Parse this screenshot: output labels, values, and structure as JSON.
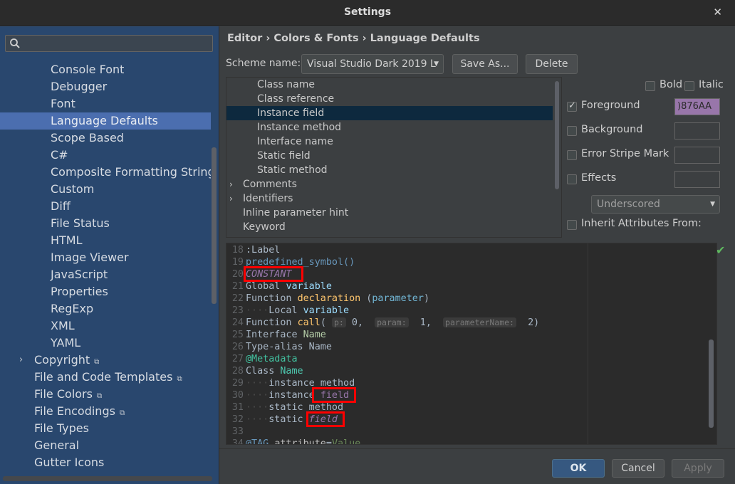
{
  "window": {
    "title": "Settings"
  },
  "sidebar": {
    "search_placeholder": "",
    "items": [
      {
        "label": "Console Font",
        "indent": 2
      },
      {
        "label": "Debugger",
        "indent": 2
      },
      {
        "label": "Font",
        "indent": 2
      },
      {
        "label": "Language Defaults",
        "indent": 2,
        "selected": true
      },
      {
        "label": "Scope Based",
        "indent": 2
      },
      {
        "label": "C#",
        "indent": 2
      },
      {
        "label": "Composite Formatting String",
        "indent": 2
      },
      {
        "label": "Custom",
        "indent": 2
      },
      {
        "label": "Diff",
        "indent": 2
      },
      {
        "label": "File Status",
        "indent": 2
      },
      {
        "label": "HTML",
        "indent": 2
      },
      {
        "label": "Image Viewer",
        "indent": 2
      },
      {
        "label": "JavaScript",
        "indent": 2
      },
      {
        "label": "Properties",
        "indent": 2
      },
      {
        "label": "RegExp",
        "indent": 2
      },
      {
        "label": "XML",
        "indent": 2
      },
      {
        "label": "YAML",
        "indent": 2
      },
      {
        "label": "Copyright",
        "indent": 1,
        "expandable": true,
        "copy_icon": true
      },
      {
        "label": "File and Code Templates",
        "indent": 1,
        "copy_icon": true
      },
      {
        "label": "File Colors",
        "indent": 1,
        "copy_icon": true
      },
      {
        "label": "File Encodings",
        "indent": 1,
        "copy_icon": true
      },
      {
        "label": "File Types",
        "indent": 1
      },
      {
        "label": "General",
        "indent": 1
      },
      {
        "label": "Gutter Icons",
        "indent": 1
      }
    ]
  },
  "breadcrumb": "Editor › Colors & Fonts › Language Defaults",
  "scheme": {
    "label": "Scheme name:",
    "value": "Visual Studio Dark 2019 L",
    "save_as": "Save As...",
    "delete": "Delete"
  },
  "attributes": {
    "items": [
      {
        "label": "Class name",
        "level": 1
      },
      {
        "label": "Class reference",
        "level": 1
      },
      {
        "label": "Instance field",
        "level": 1,
        "selected": true
      },
      {
        "label": "Instance method",
        "level": 1
      },
      {
        "label": "Interface name",
        "level": 1
      },
      {
        "label": "Static field",
        "level": 1
      },
      {
        "label": "Static method",
        "level": 1
      },
      {
        "label": "Comments",
        "level": 0,
        "expandable": true
      },
      {
        "label": "Identifiers",
        "level": 0,
        "expandable": true
      },
      {
        "label": "Inline parameter hint",
        "level": 0
      },
      {
        "label": "Keyword",
        "level": 0
      }
    ]
  },
  "options": {
    "bold": "Bold",
    "italic": "Italic",
    "foreground": "Foreground",
    "foreground_value": ")876AA",
    "foreground_color": "#9876aa",
    "background": "Background",
    "error_stripe": "Error Stripe Mark",
    "effects": "Effects",
    "effects_type": "Underscored",
    "inherit": "Inherit Attributes From:"
  },
  "preview": {
    "lines": [
      {
        "n": "18",
        "parts": [
          [
            "k-label",
            ":Label"
          ]
        ]
      },
      {
        "n": "19",
        "parts": [
          [
            "k-predef",
            "predefined_symbol()"
          ]
        ]
      },
      {
        "n": "20",
        "parts": [
          [
            "k-const",
            "CONSTANT"
          ]
        ]
      },
      {
        "n": "21",
        "parts": [
          [
            "",
            "Global "
          ],
          [
            "k-var",
            "variable"
          ]
        ]
      },
      {
        "n": "22",
        "parts": [
          [
            "",
            "Function "
          ],
          [
            "k-func",
            "declaration"
          ],
          [
            "",
            " ("
          ],
          [
            "k-param",
            "parameter"
          ],
          [
            "",
            ")"
          ]
        ]
      },
      {
        "n": "23",
        "parts": [
          [
            "indent",
            "····"
          ],
          [
            "",
            "Local "
          ],
          [
            "k-var",
            "variable"
          ]
        ]
      },
      {
        "n": "24",
        "parts": [
          [
            "",
            "Function "
          ],
          [
            "k-func",
            "call"
          ],
          [
            "",
            "( "
          ],
          [
            "hint",
            "p:"
          ],
          [
            "",
            " 0,  "
          ],
          [
            "hint",
            "param:"
          ],
          [
            "",
            "  1,  "
          ],
          [
            "hint",
            "parameterName:"
          ],
          [
            "",
            "  2)"
          ]
        ]
      },
      {
        "n": "25",
        "parts": [
          [
            "",
            "Interface "
          ],
          [
            "k-iface",
            "Name"
          ]
        ]
      },
      {
        "n": "26",
        "parts": [
          [
            "",
            "Type-alias Name"
          ]
        ]
      },
      {
        "n": "27",
        "parts": [
          [
            "k-meta",
            "@Metadata"
          ]
        ]
      },
      {
        "n": "28",
        "parts": [
          [
            "",
            "Class "
          ],
          [
            "k-cls",
            "Name"
          ]
        ]
      },
      {
        "n": "29",
        "parts": [
          [
            "indent",
            "····"
          ],
          [
            "",
            "instance "
          ],
          [
            "",
            "method"
          ]
        ]
      },
      {
        "n": "30",
        "parts": [
          [
            "indent",
            "····"
          ],
          [
            "",
            "instance "
          ],
          [
            "k-field",
            "field"
          ]
        ]
      },
      {
        "n": "31",
        "parts": [
          [
            "indent",
            "····"
          ],
          [
            "",
            "static method"
          ]
        ]
      },
      {
        "n": "32",
        "parts": [
          [
            "indent",
            "····"
          ],
          [
            "",
            "static "
          ],
          [
            "k-sfield",
            "field"
          ]
        ]
      },
      {
        "n": "33",
        "parts": []
      },
      {
        "n": "34",
        "parts": [
          [
            "k-tag",
            "@TAG"
          ],
          [
            "",
            " "
          ],
          [
            "k-attr",
            "attribute"
          ],
          [
            "",
            "="
          ],
          [
            "k-val",
            "Value"
          ]
        ]
      }
    ]
  },
  "footer": {
    "ok": "OK",
    "cancel": "Cancel",
    "apply": "Apply"
  }
}
